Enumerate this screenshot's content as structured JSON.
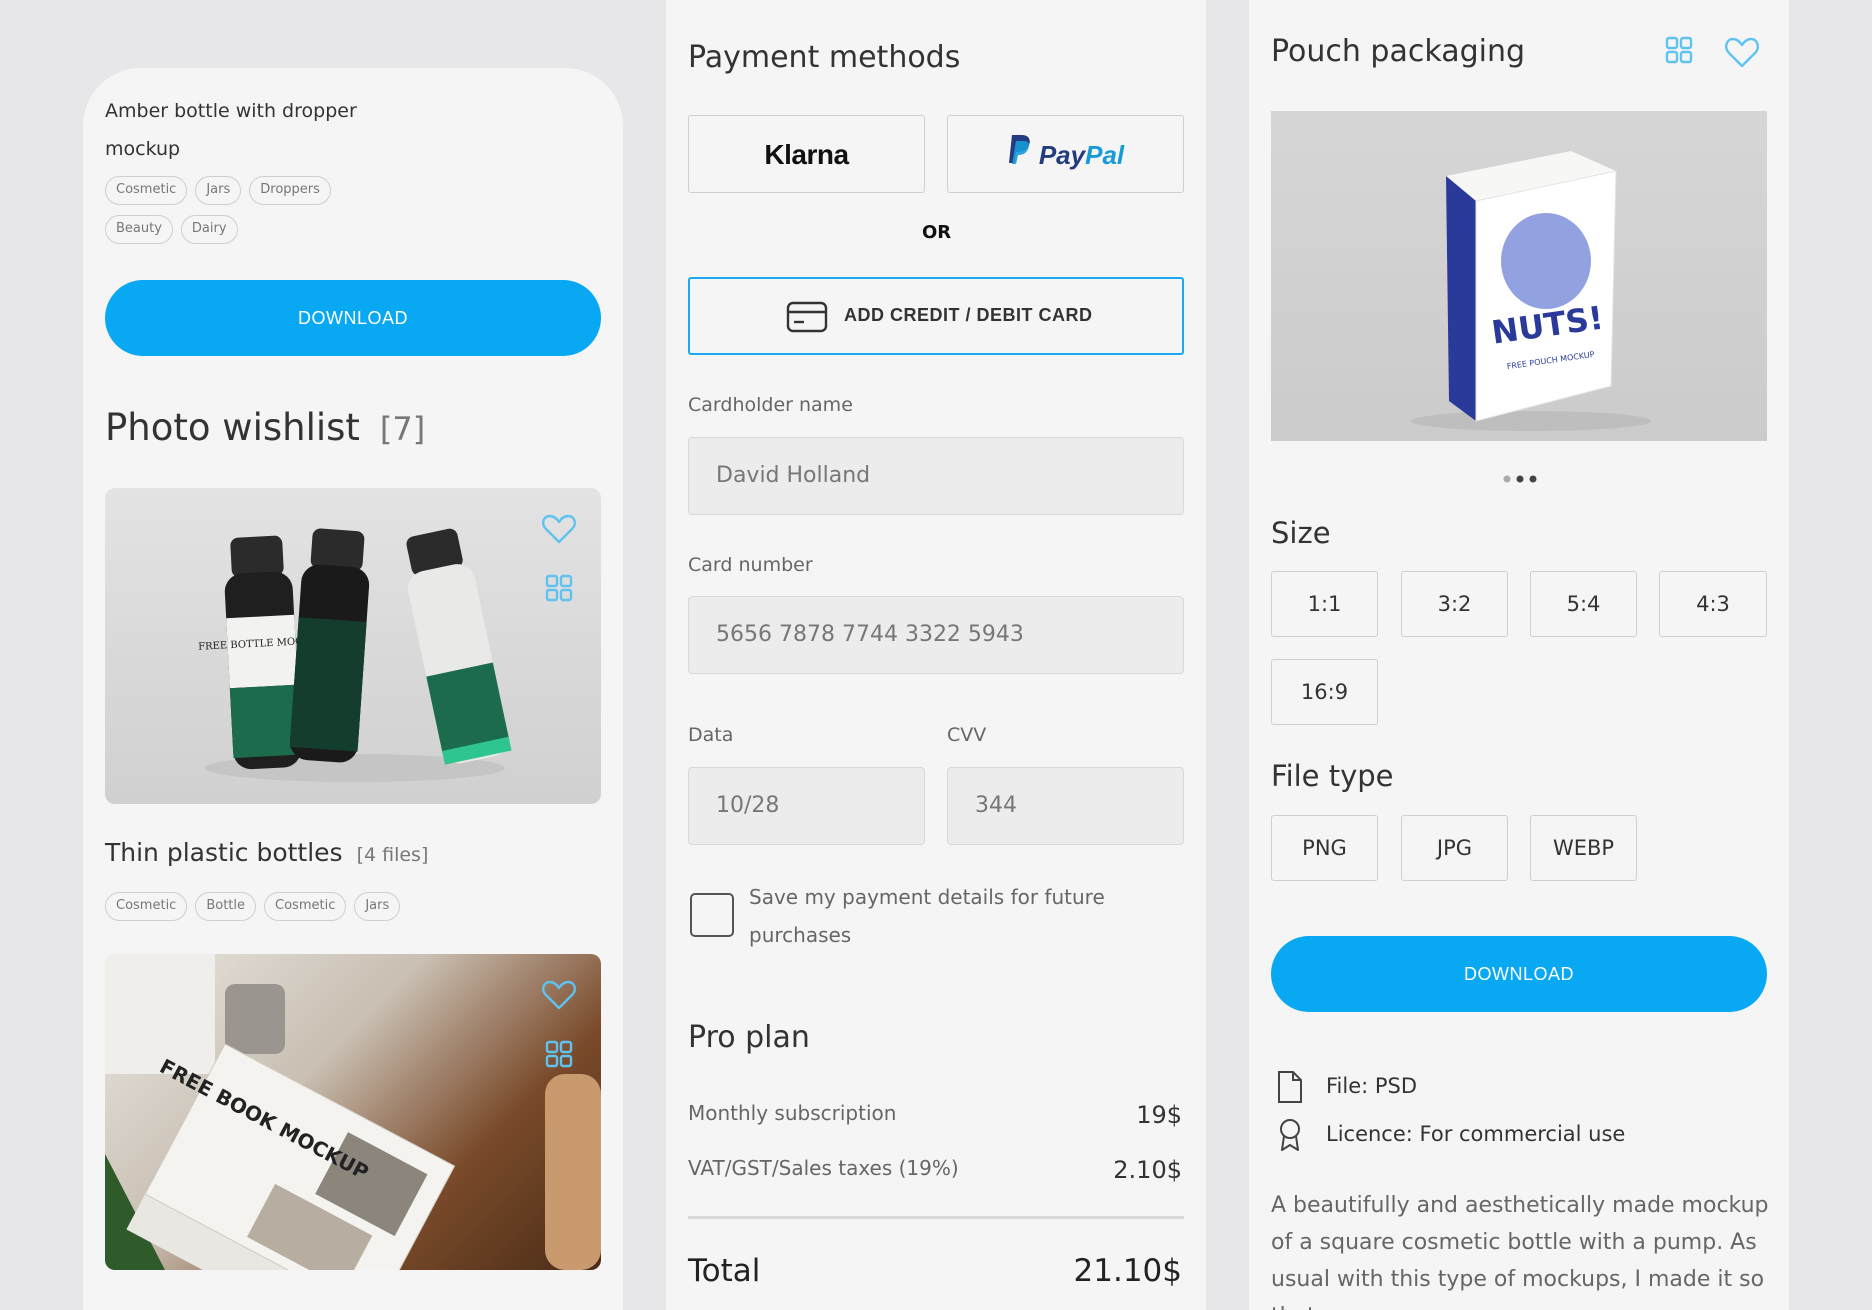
{
  "product_card": {
    "title": "Amber bottle with dropper mockup",
    "tags": [
      "Cosmetic",
      "Jars",
      "Droppers",
      "Beauty",
      "Dairy"
    ],
    "download_label": "DOWNLOAD"
  },
  "wishlist": {
    "title": "Photo wishlist",
    "count": "[7]",
    "items": [
      {
        "title": "Thin plastic bottles",
        "files": "[4 files]",
        "tags": [
          "Cosmetic",
          "Bottle",
          "Cosmetic",
          "Jars"
        ],
        "image_label": "FREE BOTTLE MOCKUP"
      },
      {
        "image_label": "FREE BOOK MOCKUP"
      }
    ]
  },
  "payment": {
    "title": "Payment methods",
    "klarna_label": "Klarna",
    "paypal_label_1": "Pay",
    "paypal_label_2": "Pal",
    "or_label": "OR",
    "add_card_label": "ADD CREDIT / DEBIT CARD",
    "cardholder_label": "Cardholder name",
    "cardholder_value": "David Holland",
    "card_number_label": "Card number",
    "card_number_value": "5656 7878 7744 3322 5943",
    "date_label": "Data",
    "date_value": "10/28",
    "cvv_label": "CVV",
    "cvv_value": "344",
    "save_label": "Save my payment details for future purchases",
    "plan_title": "Pro plan",
    "monthly_label": "Monthly subscription",
    "monthly_value": "19$",
    "vat_label": "VAT/GST/Sales taxes (19%)",
    "vat_value": "2.10$",
    "total_label": "Total",
    "total_value": "21.10$"
  },
  "product_detail": {
    "title": "Pouch packaging",
    "image_label": "NUTS!",
    "image_sub": "FREE POUCH MOCKUP",
    "size_title": "Size",
    "sizes": [
      "1:1",
      "3:2",
      "5:4",
      "4:3",
      "16:9"
    ],
    "file_type_title": "File type",
    "file_types": [
      "PNG",
      "JPG",
      "WEBP"
    ],
    "download_label": "DOWNLOAD",
    "file_info": "File: PSD",
    "licence_info": "Licence: For commercial use",
    "description": "A beautifully and aesthetically made mockup of a square cosmetic bottle with a pump. As usual with this type of mockups, I made it so that you"
  },
  "colors": {
    "accent": "#08a9f2",
    "icon_blue": "#5ec3f0"
  }
}
